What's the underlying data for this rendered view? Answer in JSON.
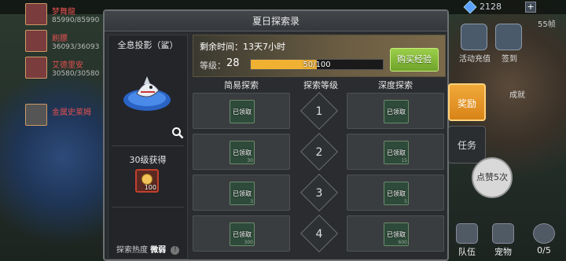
{
  "hud": {
    "gems": "2128",
    "plus": "+",
    "fps": "55帧"
  },
  "team": [
    {
      "name": "梦舞龍",
      "hp": "85990/85990"
    },
    {
      "name": "刷膘",
      "hp": "36093/36093"
    },
    {
      "name": "艾德里安",
      "hp": "30580/30580"
    },
    {
      "name": "金属史莱姆",
      "hp": ""
    }
  ],
  "world": {
    "activity_label": "活动充值",
    "sign_label": "签到",
    "achievement_label": "成就"
  },
  "panel": {
    "title": "夏日探索录",
    "hologram_title": "全息投影（鲨）",
    "reward_title": "30级获得",
    "reward_qty": "100",
    "heat_label": "探索热度",
    "heat_value": "微弱",
    "info_glyph": "!",
    "time_label": "剩余时间：13天7小时",
    "level_label": "等级：",
    "level_value": "28",
    "xp_text": "50/100",
    "xp_fraction": 0.5,
    "buy_button": "购买经验",
    "col_easy": "简易探索",
    "col_level": "探索等级",
    "col_deep": "深度探索",
    "rows": [
      {
        "level": "1",
        "easy": "已领取",
        "deep": "已领取",
        "easy_q": "",
        "deep_q": ""
      },
      {
        "level": "2",
        "easy": "已领取",
        "deep": "已领取",
        "easy_q": "30",
        "deep_q": "15"
      },
      {
        "level": "3",
        "easy": "已领取",
        "deep": "已领取",
        "easy_q": "3",
        "deep_q": "5"
      },
      {
        "level": "4",
        "easy": "已领取",
        "deep": "已领取",
        "easy_q": "300",
        "deep_q": "600"
      }
    ]
  },
  "tabs": {
    "reward": "奖励",
    "task": "任务"
  },
  "like_button": "点赞5次",
  "bottom": {
    "team": "队伍",
    "pet": "宠物",
    "count": "0/5"
  },
  "icons": {
    "gem": "gem-icon",
    "search": "search-icon",
    "shark": "shark-hologram-icon",
    "coin": "coin-icon",
    "info": "info-icon"
  }
}
